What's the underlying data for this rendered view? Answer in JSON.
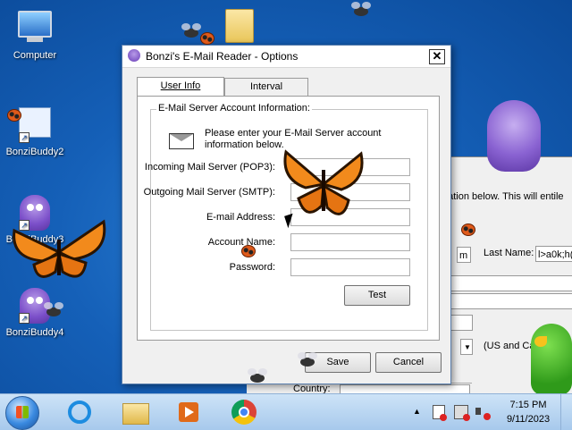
{
  "desktop": {
    "icons": [
      {
        "label": "Computer"
      },
      {
        "label": "BonziBuddy2"
      },
      {
        "label": "BonziBuddy3"
      },
      {
        "label": "BonziBuddy4"
      }
    ]
  },
  "dialog": {
    "title": "Bonzi's E-Mail Reader - Options",
    "close_label": "✕",
    "tabs": [
      {
        "label": "User Info",
        "active": true
      },
      {
        "label": "Interval",
        "active": false
      }
    ],
    "group_title": "E-Mail Server Account Information:",
    "intro_text": "Please enter your E-Mail Server account information below.",
    "fields": [
      {
        "label": "Incoming Mail Server (POP3):",
        "value": ""
      },
      {
        "label": "Outgoing Mail Server (SMTP):",
        "value": ""
      },
      {
        "label": "E-mail Address:",
        "value": ""
      },
      {
        "label": "Account Name:",
        "value": ""
      },
      {
        "label": "Password:",
        "value": ""
      }
    ],
    "test_button": "Test",
    "save_button": "Save",
    "cancel_button": "Cancel"
  },
  "background_window": {
    "fragment_text": "nation below.  This will entile",
    "field_label_m": "m",
    "last_name_label": "Last Name:",
    "last_name_value": "l>a0k;h(",
    "country_select_text": "(US and Cana",
    "country_label": "Country:"
  },
  "taskbar": {
    "time": "7:15 PM",
    "date": "9/11/2023",
    "tray_up_arrow": "▲"
  },
  "colors": {
    "desktop_bg": "#1560b8",
    "dialog_bg": "#f0f0f0",
    "taskbar_bg": "#b9d4f1",
    "bonzi_purple": "#7b4fc9"
  }
}
